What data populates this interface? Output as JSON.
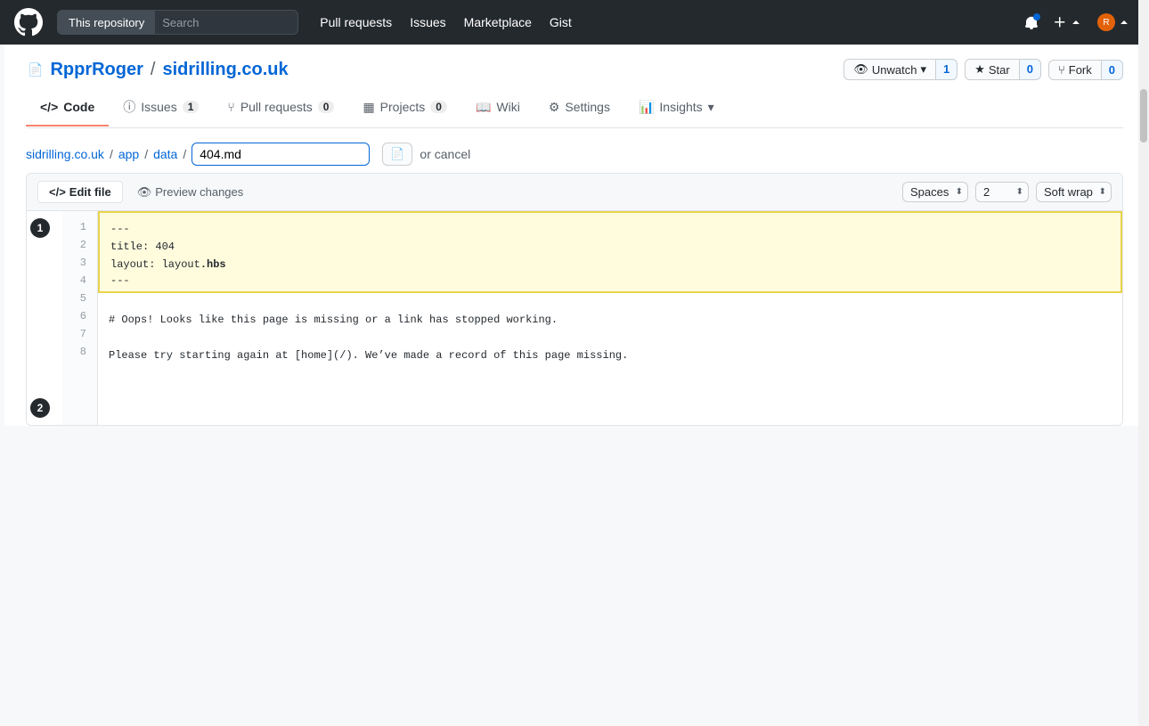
{
  "header": {
    "repo_label": "This repository",
    "search_placeholder": "Search",
    "nav": {
      "pull_requests": "Pull requests",
      "issues": "Issues",
      "marketplace": "Marketplace",
      "gist": "Gist"
    }
  },
  "repo": {
    "owner": "RpprRoger",
    "name": "sidrilling.co.uk",
    "watch_label": "Unwatch",
    "watch_count": "1",
    "star_label": "Star",
    "star_count": "0",
    "fork_label": "Fork",
    "fork_count": "0"
  },
  "tabs": {
    "code": "Code",
    "issues": "Issues",
    "issues_count": "1",
    "pull_requests": "Pull requests",
    "pull_requests_count": "0",
    "projects": "Projects",
    "projects_count": "0",
    "wiki": "Wiki",
    "settings": "Settings",
    "insights": "Insights"
  },
  "breadcrumb": {
    "root": "sidrilling.co.uk",
    "part1": "app",
    "part2": "data",
    "filename": "404.md",
    "or_cancel": "or cancel"
  },
  "editor": {
    "edit_file_label": "Edit file",
    "preview_label": "Preview changes",
    "spaces_label": "Spaces",
    "indent_value": "2",
    "soft_wrap_label": "Soft wrap",
    "code_lines": [
      {
        "num": "1",
        "text": "---",
        "highlighted": true
      },
      {
        "num": "2",
        "text": "title: 404",
        "highlighted": true
      },
      {
        "num": "3",
        "text": "layout: layout.hbs",
        "highlighted": true
      },
      {
        "num": "4",
        "text": "---",
        "highlighted": true
      },
      {
        "num": "5",
        "text": "",
        "highlighted": false
      },
      {
        "num": "6",
        "text": "# Oops! Looks like this page is missing or a link has stopped working.",
        "highlighted": false
      },
      {
        "num": "7",
        "text": "",
        "highlighted": false
      },
      {
        "num": "8",
        "text": "Please try starting again at [home](/). We've made a record of this page missing.",
        "highlighted": false
      }
    ]
  },
  "conflict_markers": [
    {
      "num": "1"
    },
    {
      "num": "2"
    }
  ],
  "icons": {
    "logo": "github",
    "code": "</>",
    "eye": "👁",
    "star": "★",
    "fork": "⑂",
    "issue": "ⓘ",
    "pr": "⑂",
    "project": "▦",
    "book": "📖",
    "gear": "⚙",
    "chart": "📊",
    "edit_code": "</>",
    "preview_eye": "👁",
    "bell": "🔔",
    "plus": "+",
    "file_icon": "📄"
  }
}
